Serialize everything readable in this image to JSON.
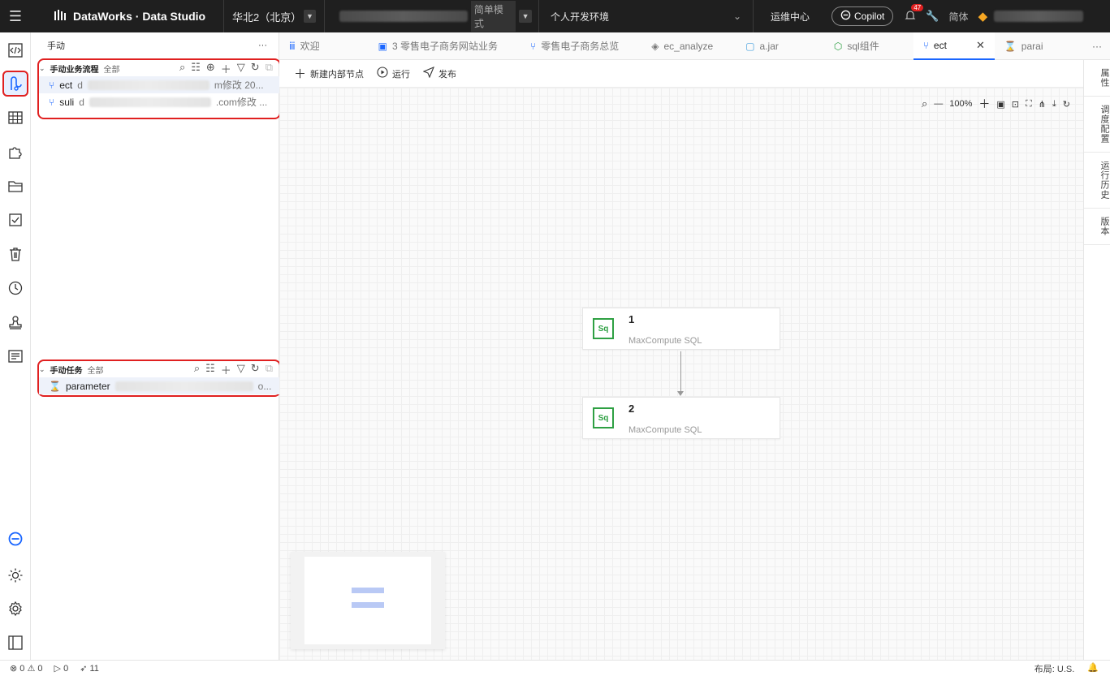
{
  "topbar": {
    "product_name": "DataWorks · Data Studio",
    "region": "华北2（北京）",
    "mode": "简单模式",
    "environment": "个人开发环境",
    "ops_center": "运维中心",
    "copilot": "Copilot",
    "notification_count": "47",
    "language": "简体"
  },
  "explorer": {
    "title": "手动",
    "more": "···",
    "workflow_section": {
      "title": "手动业务流程",
      "filter": "全部",
      "items": [
        {
          "name": "ect",
          "prefix": "d",
          "suffix": "m修改 20..."
        },
        {
          "name": "suli",
          "prefix": "d",
          "suffix": ".com修改 ..."
        }
      ]
    },
    "task_section": {
      "title": "手动任务",
      "filter": "全部",
      "items": [
        {
          "name": "parameter",
          "suffix": "o..."
        }
      ]
    }
  },
  "tabs": [
    {
      "label": "欢迎",
      "icon": "dataworks-icon"
    },
    {
      "label": "3 零售电子商务网站业务",
      "icon": "document-icon"
    },
    {
      "label": "零售电子商务总览",
      "icon": "workflow-icon"
    },
    {
      "label": "ec_analyze",
      "icon": "layers-icon"
    },
    {
      "label": "a.jar",
      "icon": "jar-icon"
    },
    {
      "label": "sql组件",
      "icon": "component-icon"
    },
    {
      "label": "ect",
      "icon": "workflow-icon",
      "active": true
    },
    {
      "label": "parai",
      "icon": "parameter-icon"
    }
  ],
  "toolbar": {
    "new_node": "新建内部节点",
    "run": "运行",
    "publish": "发布"
  },
  "canvas": {
    "zoom": "100%",
    "nodes": [
      {
        "title": "1",
        "subtitle": "MaxCompute SQL",
        "icon_text": "Sq"
      },
      {
        "title": "2",
        "subtitle": "MaxCompute SQL",
        "icon_text": "Sq"
      }
    ]
  },
  "right_rail": [
    "属性",
    "调度配置",
    "运行历史",
    "版本"
  ],
  "statusbar": {
    "errors": "0",
    "warnings": "0",
    "runs": "0",
    "publishes": "11",
    "layout": "布局: U.S."
  },
  "colors": {
    "accent": "#1a66ff",
    "highlight": "#e02020",
    "sql_node": "#2ea043",
    "topbar_bg": "#1f1f1f"
  }
}
